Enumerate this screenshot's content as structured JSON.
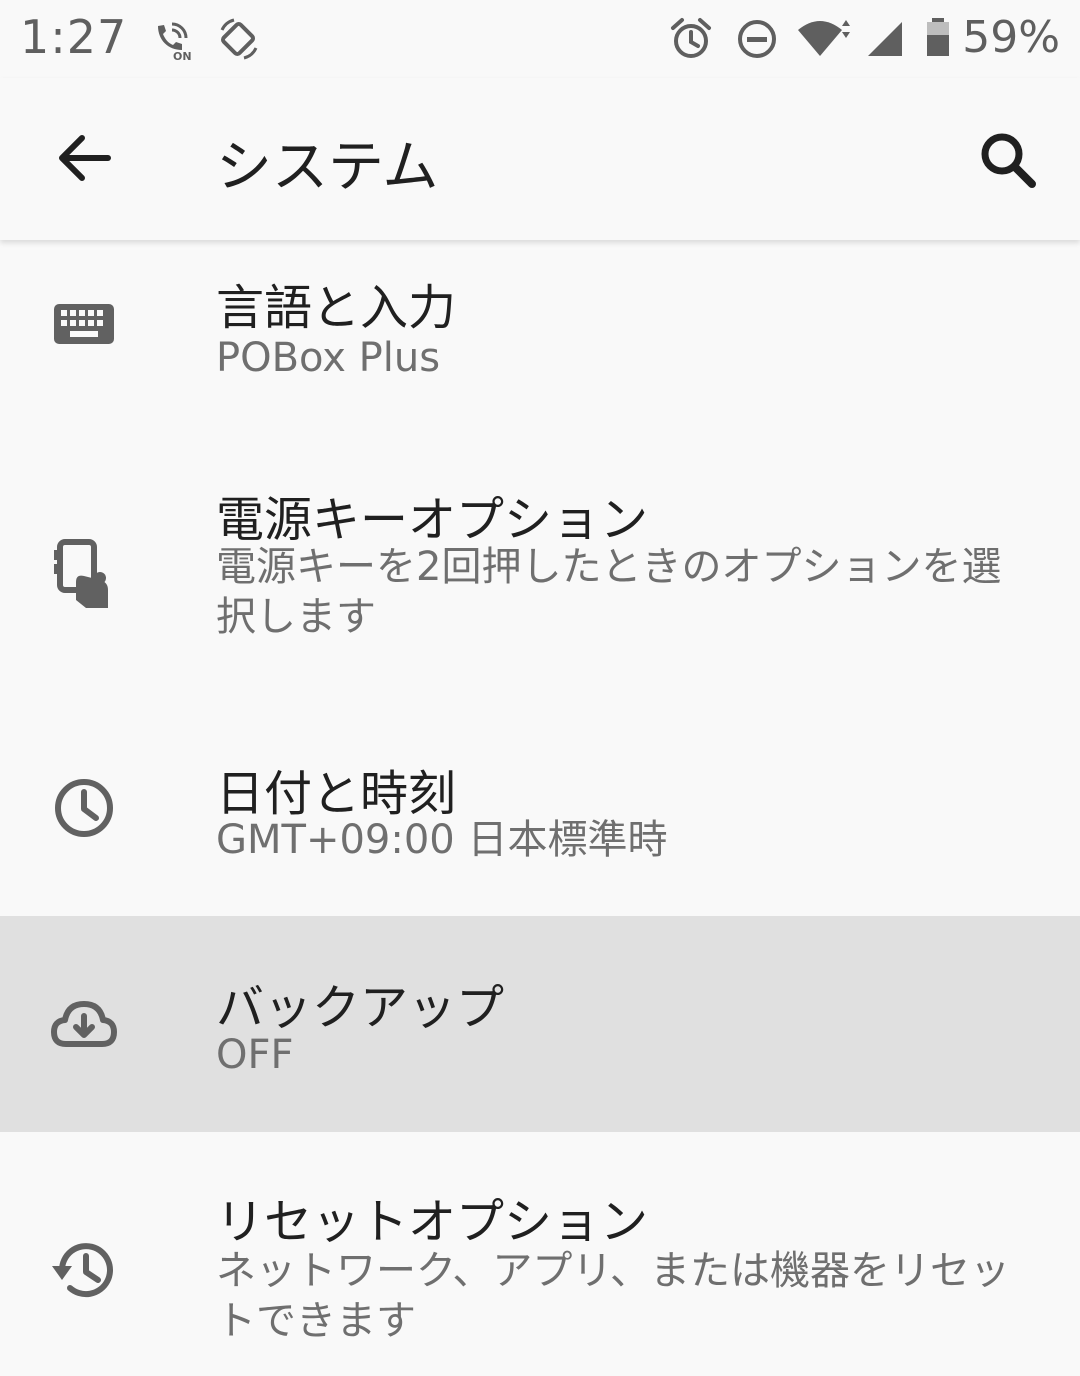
{
  "status_bar": {
    "time": "1:27",
    "battery": "59%",
    "icons": [
      "volte-on-icon",
      "auto-rotate-icon",
      "alarm-icon",
      "do-not-disturb-icon",
      "wifi-icon",
      "signal-icon",
      "battery-icon"
    ]
  },
  "app_bar": {
    "title": "システム",
    "back_icon": "arrow-back-icon",
    "search_icon": "search-icon"
  },
  "items": [
    {
      "title": "言語と入力",
      "summary": "POBox Plus",
      "icon": "keyboard-icon"
    },
    {
      "title": "電源キーオプション",
      "summary": "電源キーを2回押したときのオプションを選択します",
      "icon": "power-key-phone-icon"
    },
    {
      "title": "日付と時刻",
      "summary": "GMT+09:00 日本標準時",
      "icon": "clock-icon"
    },
    {
      "title": "バックアップ",
      "summary": "OFF",
      "icon": "cloud-download-icon",
      "state": "pressed"
    },
    {
      "title": "リセットオプション",
      "summary": "ネットワーク、アプリ、または機器をリセットできます",
      "icon": "reset-history-icon"
    }
  ],
  "colors": {
    "background": "#f9f9f9",
    "pressed_row": "#e0e0e0",
    "icon": "#616161",
    "title_text": "#202020",
    "summary_text": "#6f6f6f"
  }
}
